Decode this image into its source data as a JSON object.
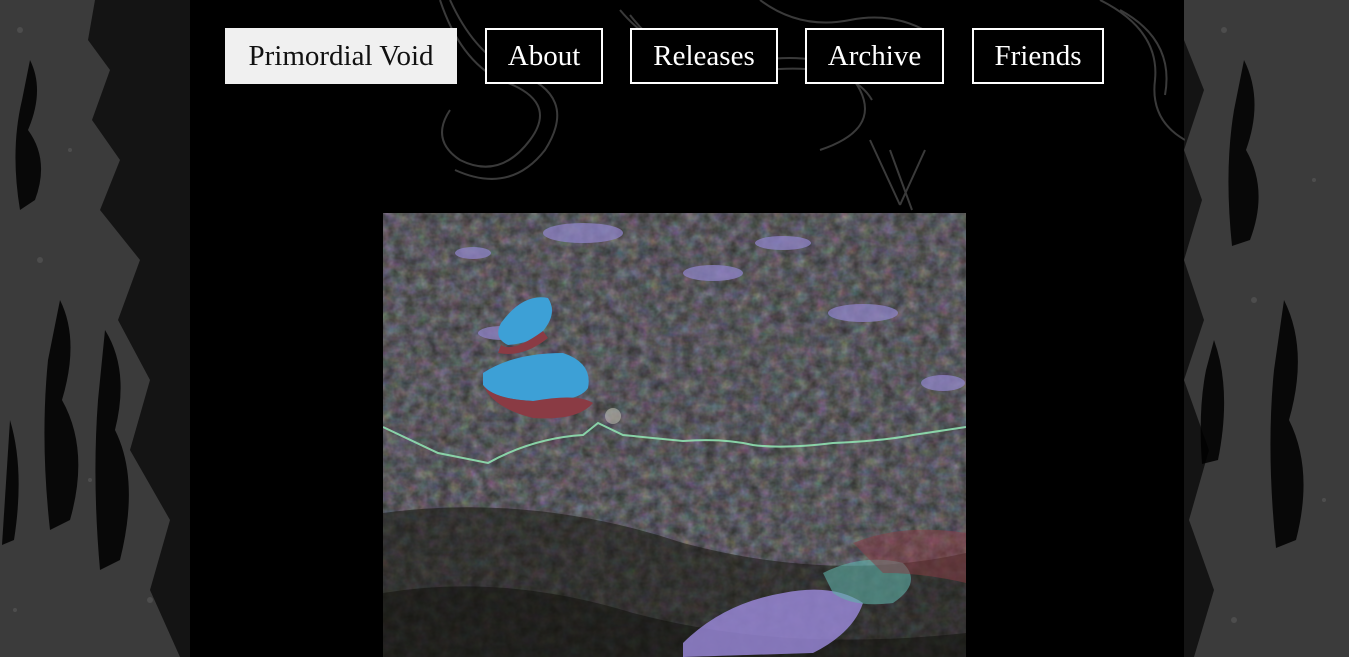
{
  "nav": {
    "items": [
      {
        "label": "Primordial Void",
        "active": true
      },
      {
        "label": "About",
        "active": false
      },
      {
        "label": "Releases",
        "active": false
      },
      {
        "label": "Archive",
        "active": false
      },
      {
        "label": "Friends",
        "active": false
      }
    ]
  },
  "colors": {
    "background": "#000000",
    "nav_border": "#ffffff",
    "nav_active_bg": "#f0f0f0",
    "texture": "#3a3a3a"
  }
}
